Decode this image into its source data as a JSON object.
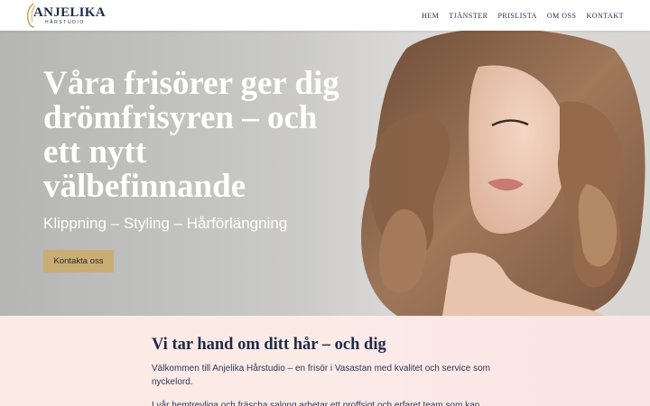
{
  "header": {
    "logo": {
      "name": "ANJELIKA",
      "subtitle": "HÅRSTUDIO"
    },
    "nav": [
      {
        "label": "HEM"
      },
      {
        "label": "TJÄNSTER"
      },
      {
        "label": "PRISLISTA"
      },
      {
        "label": "OM OSS"
      },
      {
        "label": "KONTAKT"
      }
    ]
  },
  "hero": {
    "title": "Våra frisörer ger dig drömfrisyren – och ett nytt välbefinnande",
    "subtitle": "Klippning – Styling – Hårförlängning",
    "button_label": "Kontakta oss"
  },
  "intro": {
    "title": "Vi tar hand om ditt hår – och dig",
    "paragraph1": "Välkommen till Anjelika Hårstudio – en frisör i Vasastan med kvalitet och service som nyckelord.",
    "paragraph2": "I vår hemtrevliga och fräscha salong arbetar ett proffsigt och erfaret team som kan"
  },
  "colors": {
    "navy": "#1e2a4a",
    "gold": "#c9ae74",
    "blush": "#fbe9e4"
  }
}
